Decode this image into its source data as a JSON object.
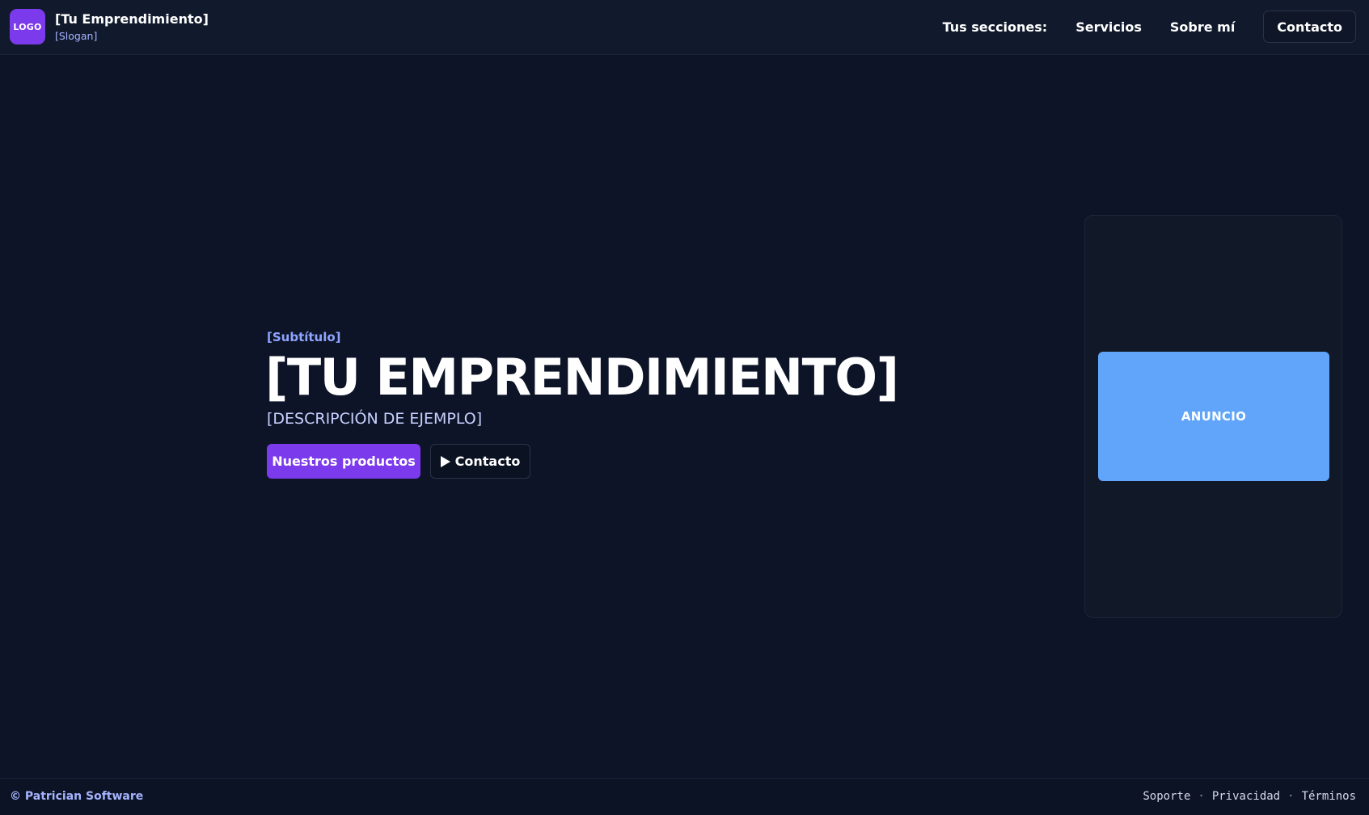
{
  "header": {
    "logo_text": "LOGO",
    "brand_name": "[Tu Emprendimiento]",
    "slogan": "[Slogan]",
    "nav_label": "Tus secciones:",
    "nav_links": [
      "Servicios",
      "Sobre mí"
    ],
    "contact_button": "Contacto"
  },
  "hero": {
    "subtitle": "[Subtítulo]",
    "title": "[TU EMPRENDIMIENTO]",
    "description": "[DESCRIPCIÓN DE EJEMPLO]",
    "primary_button": "Nuestros productos",
    "secondary_button": "Contacto",
    "secondary_icon": "play-icon"
  },
  "ad": {
    "label": "ANUNCIO",
    "color": "#60a5fa"
  },
  "footer": {
    "copyright": "© Patrician Software",
    "links": [
      "Soporte",
      "Privacidad",
      "Términos"
    ],
    "separator": "·"
  },
  "colors": {
    "background": "#0d1427",
    "accent": "#7c3aed",
    "ad_blue": "#60a5fa",
    "subtitle": "#8fa5ff"
  }
}
